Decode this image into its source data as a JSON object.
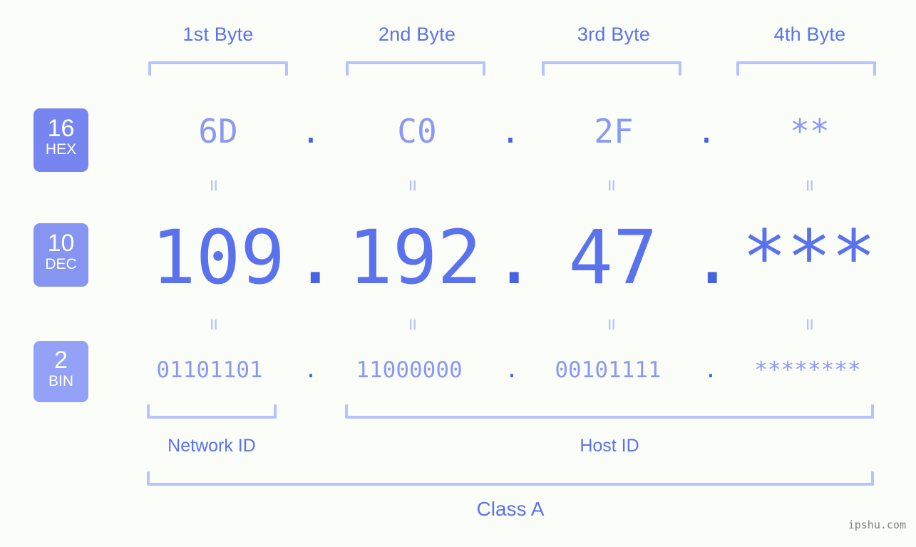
{
  "watermark": "ipshu.com",
  "byte_headers": [
    {
      "label": "1st Byte"
    },
    {
      "label": "2nd Byte"
    },
    {
      "label": "3rd Byte"
    },
    {
      "label": "4th Byte"
    }
  ],
  "radix_badges": [
    {
      "number": "16",
      "name": "HEX",
      "color": "#7685ef"
    },
    {
      "number": "10",
      "name": "DEC",
      "color": "#8694f2"
    },
    {
      "number": "2",
      "name": "BIN",
      "color": "#93a1f6"
    }
  ],
  "separator": ".",
  "equals_glyph": "=",
  "rows": {
    "hex": {
      "label": "HEX",
      "radix": "16",
      "values": [
        "6D",
        "C0",
        "2F",
        "**"
      ]
    },
    "dec": {
      "label": "DEC",
      "radix": "10",
      "values": [
        "109",
        "192",
        "47",
        "***"
      ]
    },
    "bin": {
      "label": "BIN",
      "radix": "2",
      "values": [
        "01101101",
        "11000000",
        "00101111",
        "********"
      ]
    }
  },
  "segments": {
    "network_id": "Network ID",
    "host_id": "Host ID",
    "class": "Class A"
  },
  "colors": {
    "background": "#fbfdf8",
    "accent": "#5b72ef",
    "accent_light": "#8a99f3",
    "bracket": "#b8c2fb",
    "dot": "#4763e4",
    "watermark": "#7f7f7f"
  }
}
